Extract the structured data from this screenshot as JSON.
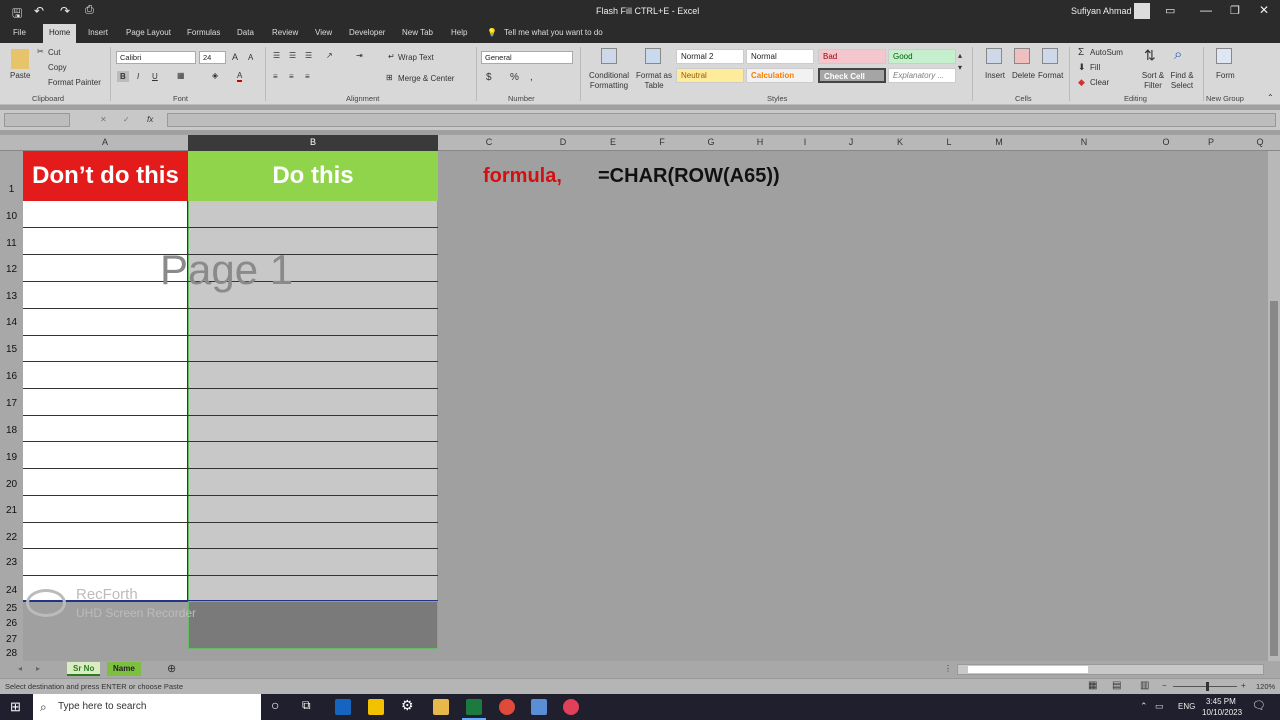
{
  "title": {
    "document": "Flash Fill CTRL+E  -  Excel",
    "user": "Sufiyan Ahmad"
  },
  "tabs": [
    "File",
    "Home",
    "Insert",
    "Page Layout",
    "Formulas",
    "Data",
    "Review",
    "View",
    "Developer",
    "New Tab",
    "Help"
  ],
  "tell_me": "Tell me what you want to do",
  "clipboard": {
    "paste": "Paste",
    "cut": "Cut",
    "copy": "Copy",
    "format_painter": "Format Painter",
    "label": "Clipboard"
  },
  "font": {
    "name": "Calibri",
    "size": "24",
    "label": "Font",
    "bold": "B",
    "italic": "I",
    "underline": "U"
  },
  "alignment": {
    "wrap": "Wrap Text",
    "merge": "Merge & Center",
    "label": "Alignment"
  },
  "number": {
    "format": "General",
    "label": "Number",
    "currency": "$",
    "percent": "%",
    "comma": ","
  },
  "styles": {
    "conditional": "Conditional Formatting",
    "format_table": "Format as Table",
    "label": "Styles",
    "items": [
      {
        "name": "Normal 2",
        "bg": "#ffffff",
        "fg": "#222"
      },
      {
        "name": "Normal",
        "bg": "#ffffff",
        "fg": "#222"
      },
      {
        "name": "Bad",
        "bg": "#f4c7ce",
        "fg": "#9c0006"
      },
      {
        "name": "Good",
        "bg": "#c6efce",
        "fg": "#006100"
      },
      {
        "name": "Neutral",
        "bg": "#ffeb9c",
        "fg": "#9c5700"
      },
      {
        "name": "Calculation",
        "bg": "#f2f2f2",
        "fg": "#fa7d00"
      },
      {
        "name": "Check Cell",
        "bg": "#a5a5a5",
        "fg": "#ffffff"
      },
      {
        "name": "Explanatory ...",
        "bg": "#ffffff",
        "fg": "#7f7f7f"
      }
    ]
  },
  "cells": {
    "insert": "Insert",
    "delete": "Delete",
    "format": "Format",
    "label": "Cells"
  },
  "editing": {
    "autosum": "AutoSum",
    "fill": "Fill",
    "clear": "Clear",
    "sort": "Sort & Filter",
    "find": "Find & Select",
    "label": "Editing"
  },
  "newgroup": {
    "form": "Form",
    "label": "New Group"
  },
  "formula_bar": {
    "fx": "fx",
    "value": ""
  },
  "columns": [
    "A",
    "B",
    "C",
    "D",
    "E",
    "F",
    "G",
    "H",
    "I",
    "J",
    "K",
    "L",
    "M",
    "N",
    "O",
    "P",
    "Q"
  ],
  "rows": [
    "1",
    "10",
    "11",
    "12",
    "13",
    "14",
    "15",
    "16",
    "17",
    "18",
    "19",
    "20",
    "21",
    "22",
    "23",
    "24",
    "25",
    "26",
    "27",
    "28"
  ],
  "sheet": {
    "header_a": "Don’t do this",
    "header_b": "Do this",
    "page_watermark": "Page 1",
    "formula_label": "formula,",
    "formula_text": "=CHAR(ROW(A65))"
  },
  "recorder": {
    "name": "RecForth",
    "sub": "UHD Screen Recorder"
  },
  "sheet_tabs": [
    "Sr No",
    "Name"
  ],
  "status": {
    "message": "Select destination and press ENTER or choose Paste",
    "zoom": "120%"
  },
  "taskbar": {
    "search": "Type here to search",
    "lang": "ENG",
    "time": "3:45 PM",
    "date": "10/10/2023"
  }
}
